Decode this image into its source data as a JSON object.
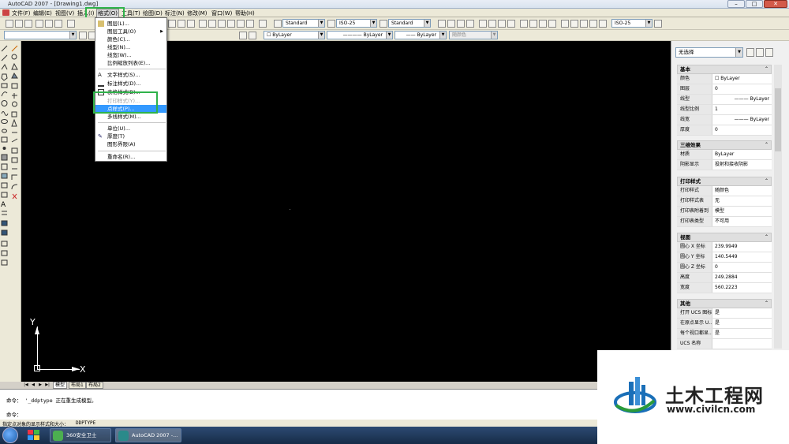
{
  "window": {
    "title": "AutoCAD 2007 - [Drawing1.dwg]"
  },
  "menubar": {
    "items": [
      "文件(F)",
      "编辑(E)",
      "视图(V)",
      "插入(I)",
      "格式(O)",
      "工具(T)",
      "绘图(D)",
      "标注(N)",
      "修改(M)",
      "窗口(W)",
      "帮助(H)"
    ],
    "active": "格式(O)"
  },
  "toolbar": {
    "text_style": "Standard",
    "dim_style": "ISO-25",
    "table_style": "Standard",
    "dim_style2": "ISO-25",
    "layer_color": "ByLayer",
    "linetype": "ByLayer",
    "lineweight": "ByLayer",
    "plotstyle": "随颜色"
  },
  "format_menu": {
    "items": [
      {
        "label": "图层(L)...",
        "state": "normal",
        "icon": "layers-icon"
      },
      {
        "label": "图层工具(O)",
        "state": "normal",
        "submenu": true
      },
      {
        "label": "颜色(C)...",
        "state": "normal"
      },
      {
        "label": "线型(N)...",
        "state": "normal"
      },
      {
        "label": "线宽(W)...",
        "state": "normal"
      },
      {
        "label": "比例缩放列表(E)...",
        "state": "normal"
      },
      {
        "separator": true
      },
      {
        "label": "文字样式(S)...",
        "state": "normal",
        "icon": "text-style-icon"
      },
      {
        "label": "标注样式(D)...",
        "state": "normal",
        "icon": "dim-style-icon"
      },
      {
        "label": "表格样式(B)...",
        "state": "normal",
        "icon": "table-style-icon"
      },
      {
        "label": "打印样式(Y)...",
        "state": "disabled"
      },
      {
        "label": "点样式(P)...",
        "state": "highlighted"
      },
      {
        "label": "多线样式(M)...",
        "state": "normal"
      },
      {
        "separator": true
      },
      {
        "label": "单位(U)...",
        "state": "normal"
      },
      {
        "label": "厚度(T)",
        "state": "normal",
        "icon": "thickness-icon"
      },
      {
        "label": "图形界限(A)",
        "state": "normal"
      },
      {
        "separator": true
      },
      {
        "label": "重命名(R)...",
        "state": "normal"
      }
    ]
  },
  "canvas": {
    "ucs_x": "X",
    "ucs_y": "Y"
  },
  "layout_tabs": [
    "模型",
    "布局1",
    "布局2"
  ],
  "command": {
    "line1": "命令： '_ddptype 正在重生成模型。",
    "line2": "命令："
  },
  "status": {
    "prompt": "指定点对象的显示样式和大小：",
    "cmdname": "DDPTYPE"
  },
  "taskbar": {
    "tasks": [
      "360安全卫士",
      "AutoCAD 2007 -..."
    ]
  },
  "properties": {
    "selection": "无选择",
    "sections": [
      {
        "title": "基本",
        "rows": [
          {
            "k": "颜色",
            "v": "ByLayer"
          },
          {
            "k": "图层",
            "v": "0"
          },
          {
            "k": "线型",
            "v": "ByLayer"
          },
          {
            "k": "线型比例",
            "v": "1"
          },
          {
            "k": "线宽",
            "v": "ByLayer"
          },
          {
            "k": "厚度",
            "v": "0"
          }
        ]
      },
      {
        "title": "三维效果",
        "rows": [
          {
            "k": "材质",
            "v": "ByLayer"
          },
          {
            "k": "阴影显示",
            "v": "投射和接收阴影"
          }
        ]
      },
      {
        "title": "打印样式",
        "rows": [
          {
            "k": "打印样式",
            "v": "随颜色"
          },
          {
            "k": "打印样式表",
            "v": "无"
          },
          {
            "k": "打印表附着到",
            "v": "模型"
          },
          {
            "k": "打印表类型",
            "v": "不可用"
          }
        ]
      },
      {
        "title": "视图",
        "rows": [
          {
            "k": "圆心 X 坐标",
            "v": "239.9949"
          },
          {
            "k": "圆心 Y 坐标",
            "v": "140.5449"
          },
          {
            "k": "圆心 Z 坐标",
            "v": "0"
          },
          {
            "k": "高度",
            "v": "249.2884"
          },
          {
            "k": "宽度",
            "v": "560.2223"
          }
        ]
      },
      {
        "title": "其他",
        "rows": [
          {
            "k": "打开 UCS 图标",
            "v": "是"
          },
          {
            "k": "在原点显示 U...",
            "v": "是"
          },
          {
            "k": "每个视口都显...",
            "v": "是"
          },
          {
            "k": "UCS 名称",
            "v": ""
          }
        ]
      }
    ]
  },
  "watermark": {
    "title": "土木工程网",
    "url": "www.civilcn.com"
  }
}
